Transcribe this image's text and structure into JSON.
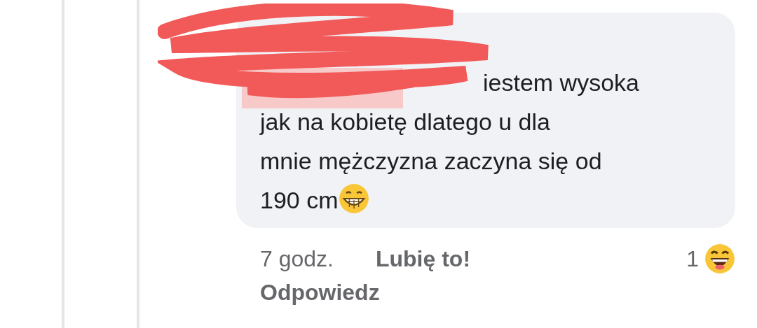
{
  "comment": {
    "author_redacted": true,
    "text_lines": [
      "iestem wysoka",
      "jak na kobietę dlatego u dla",
      "mnie mężczyzna zaczyna się od",
      "190 cm"
    ],
    "ends_with_emoji": true,
    "time": "7 godz.",
    "like_label": "Lubię to!",
    "reply_label": "Odpowiedz",
    "reaction_count": "1"
  }
}
